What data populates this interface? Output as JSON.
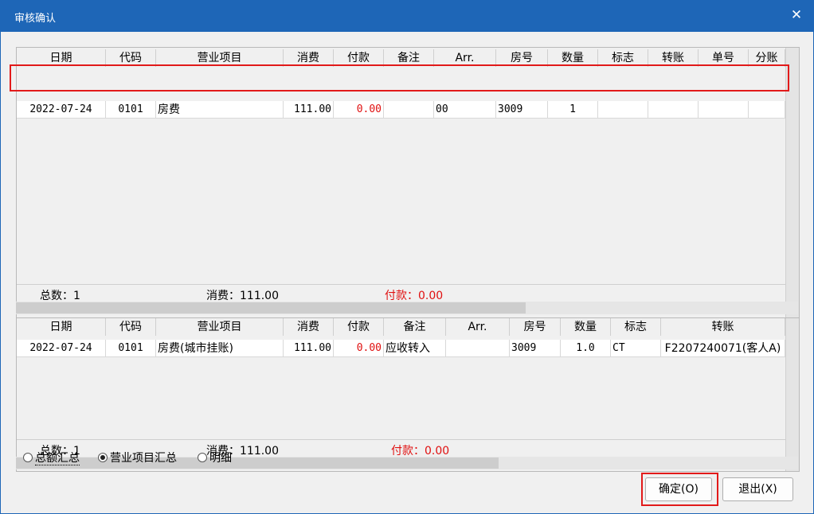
{
  "window": {
    "title": "审核确认",
    "close_glyph": "✕"
  },
  "top_table": {
    "headers": [
      "日期",
      "代码",
      "营业项目",
      "消费",
      "付款",
      "备注",
      "Arr.",
      "房号",
      "数量",
      "标志",
      "转账",
      "单号",
      "分账"
    ],
    "row": [
      "2022-07-24",
      "0101",
      "房费",
      "111.00",
      "0.00",
      "",
      "00",
      "3009",
      "1",
      "",
      "",
      "",
      ""
    ],
    "summary": {
      "count": "总数：1",
      "spend": "消费：111.00",
      "pay": "付款：0.00"
    }
  },
  "bottom_table": {
    "headers": [
      "日期",
      "代码",
      "营业项目",
      "消费",
      "付款",
      "备注",
      "Arr.",
      "房号",
      "数量",
      "标志",
      "转账"
    ],
    "row": [
      "2022-07-24",
      "0101",
      "房费(城市挂账)",
      "111.00",
      "0.00",
      "应收转入",
      "",
      "3009",
      "1.0",
      "CT",
      "F2207240071(客人A)"
    ],
    "summary": {
      "count": "总数：1",
      "spend": "消费：111.00",
      "pay": "付款：0.00"
    }
  },
  "options": [
    {
      "label": "总额汇总",
      "selected": false
    },
    {
      "label": "营业项目汇总",
      "selected": true
    },
    {
      "label": "明细",
      "selected": false
    }
  ],
  "buttons": {
    "ok": "确定(O)",
    "exit": "退出(X)"
  },
  "colors": {
    "titlebar": "#1e66b7",
    "highlight": "#e21a1a",
    "pay_text": "#e01010"
  }
}
